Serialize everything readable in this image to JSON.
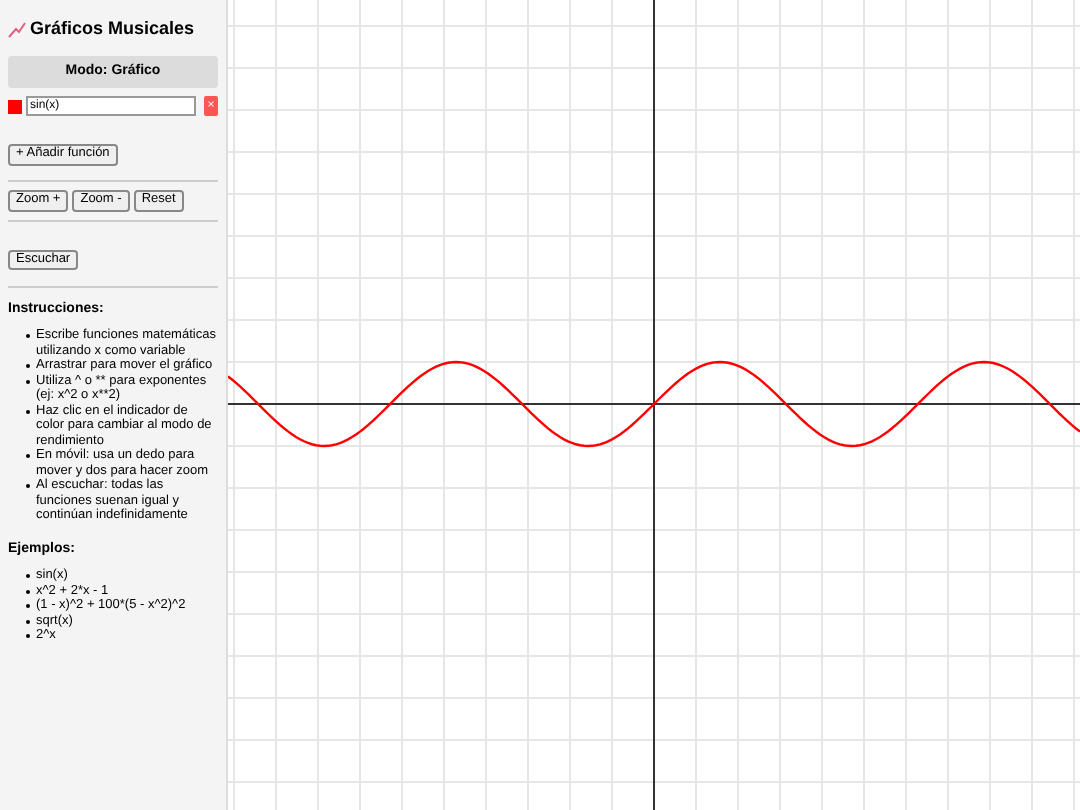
{
  "title": "Gráficos Musicales",
  "mode_label": "Modo: Gráfico",
  "functions": [
    {
      "expression": "sin(x)",
      "color": "#ff0000",
      "delete_label": "×"
    }
  ],
  "add_button": "+ Añadir función",
  "zoom_buttons": [
    "Zoom +",
    "Zoom -",
    "Reset"
  ],
  "listen_button": "Escuchar",
  "instructions": {
    "heading": "Instrucciones:",
    "items": [
      "Escribe funciones matemáticas utilizando x como variable",
      "Arrastrar para mover el gráfico",
      "Utiliza ^ o ** para exponentes (ej: x^2 o x**2)",
      "Haz clic en el indicador de color para cambiar al modo de rendimiento",
      "En móvil: usa un dedo para mover y dos para hacer zoom",
      "Al escuchar: todas las funciones suenan igual y continúan indefinidamente"
    ]
  },
  "examples": {
    "heading": "Ejemplos:",
    "items": [
      "sin(x)",
      "x^2 + 2*x - 1",
      "(1 - x)^2 + 100*(5 - x^2)^2",
      "sqrt(x)",
      "2^x"
    ]
  }
}
